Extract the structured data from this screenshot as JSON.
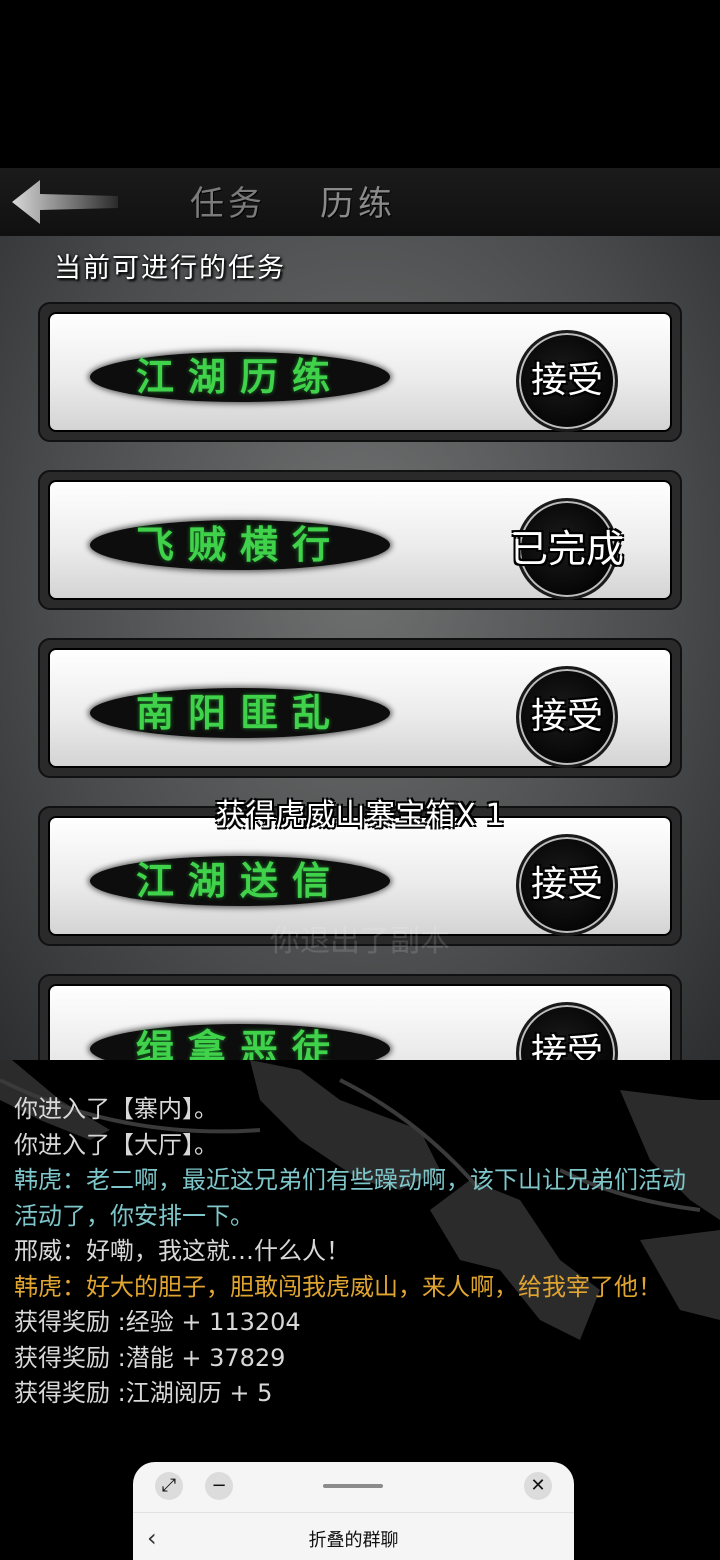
{
  "header": {
    "tabs": [
      "任务",
      "历练"
    ],
    "back_icon": "back-arrow-icon"
  },
  "panel": {
    "section_title": "当前可进行的任务",
    "quests": [
      {
        "name": "江湖历练",
        "action": "接受"
      },
      {
        "name": "飞贼横行",
        "action": "已完成"
      },
      {
        "name": "南阳匪乱",
        "action": "接受"
      },
      {
        "name": "江湖送信",
        "action": "接受"
      },
      {
        "name": "缉拿恶徒",
        "action": "接受"
      }
    ],
    "toast": "获得虎威山寨宝箱X 1",
    "faded_notice": "你退出了副本"
  },
  "log": {
    "lines": [
      {
        "text": "你进入了【寨内】。",
        "color": "white"
      },
      {
        "text": "你进入了【大厅】。",
        "color": "white"
      },
      {
        "text": "韩虎：老二啊，最近这兄弟们有些躁动啊，该下山让兄弟们活动活动了，你安排一下。",
        "color": "cyan"
      },
      {
        "text": "邢威：好嘞，我这就…什么人！",
        "color": "white"
      },
      {
        "text": "韩虎：好大的胆子，胆敢闯我虎威山，来人啊，给我宰了他！",
        "color": "yellow"
      },
      {
        "text": "获得奖励 :经验 + 113204",
        "color": "white"
      },
      {
        "text": "获得奖励 :潜能 + 37829",
        "color": "white"
      },
      {
        "text": "获得奖励 :江湖阅历 + 5",
        "color": "white"
      }
    ]
  },
  "sheet": {
    "title": "折叠的群聊",
    "icons": [
      "collapse-icon",
      "minimize-icon",
      "close-icon",
      "back-chevron-icon"
    ]
  },
  "colors": {
    "quest_green": "#3fd24a",
    "log_cyan": "#7ec6c9",
    "log_yellow": "#e0a530"
  }
}
